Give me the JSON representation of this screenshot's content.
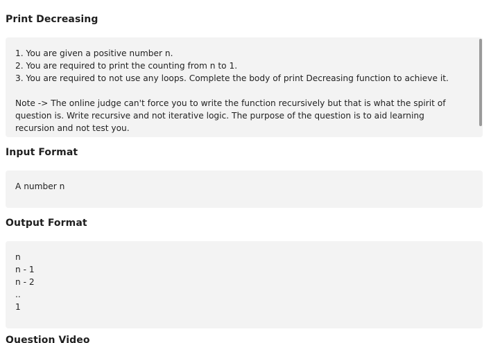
{
  "sections": {
    "description": {
      "title": "Print Decreasing",
      "lines": [
        "1. You are given a positive number n.",
        "2. You are required to print the counting from n to 1.",
        "3. You are required to not use any loops. Complete the body of print Decreasing function to achieve it.",
        "",
        "Note -> The online judge can't force you to write the function recursively but that is what the spirit of",
        "question is. Write recursive and not iterative logic. The purpose of the question is to aid learning",
        "recursion and not test you."
      ]
    },
    "input_format": {
      "title": "Input Format",
      "lines": [
        "A number n"
      ]
    },
    "output_format": {
      "title": "Output Format",
      "lines": [
        "n",
        "n - 1",
        "n - 2",
        "..",
        "1"
      ]
    },
    "question_video": {
      "title": "Question Video"
    }
  }
}
